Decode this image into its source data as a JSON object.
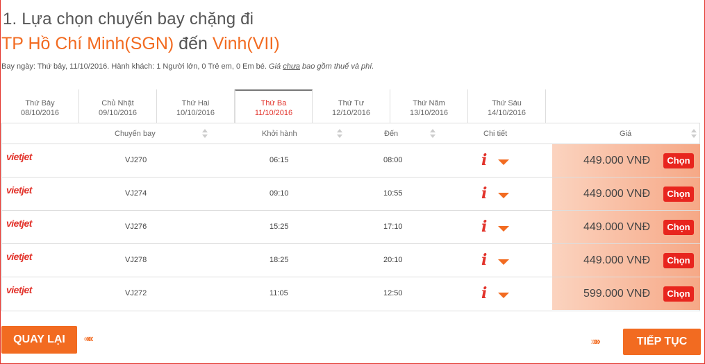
{
  "header": {
    "title": "1. Lựa chọn chuyến bay chặng đi",
    "origin": "TP Hồ Chí Minh(SGN)",
    "connector": "đến",
    "destination": "Vinh(VII)",
    "info": "Bay ngày: Thứ bảy, 11/10/2016. Hành khách: 1 Người lớn, 0 Trẻ em, 0 Em bé.",
    "tax_prefix": "Giá",
    "tax_underlined": "chưa",
    "tax_suffix": "bao gồm thuế và phí."
  },
  "date_tabs": [
    {
      "day": "Thứ Bảy",
      "date": "08/10/2016"
    },
    {
      "day": "Chủ Nhật",
      "date": "09/10/2016"
    },
    {
      "day": "Thứ Hai",
      "date": "10/10/2016"
    },
    {
      "day": "Thứ Ba",
      "date": "11/10/2016",
      "active": true
    },
    {
      "day": "Thứ Tư",
      "date": "12/10/2016"
    },
    {
      "day": "Thứ Năm",
      "date": "13/10/2016"
    },
    {
      "day": "Thứ Sáu",
      "date": "14/10/2016"
    }
  ],
  "table": {
    "headers": {
      "flight": "Chuyến bay",
      "depart": "Khởi hành",
      "arrive": "Đến",
      "detail": "Chi tiết",
      "price": "Giá"
    },
    "airline_logo": "vietjet",
    "select_label": "Chọn",
    "rows": [
      {
        "flight": "VJ270",
        "depart": "06:15",
        "arrive": "08:00",
        "price": "449.000 VNĐ"
      },
      {
        "flight": "VJ274",
        "depart": "09:10",
        "arrive": "10:55",
        "price": "449.000 VNĐ"
      },
      {
        "flight": "VJ276",
        "depart": "15:25",
        "arrive": "17:10",
        "price": "449.000 VNĐ"
      },
      {
        "flight": "VJ278",
        "depart": "18:25",
        "arrive": "20:10",
        "price": "449.000 VNĐ"
      },
      {
        "flight": "VJ272",
        "depart": "11:05",
        "arrive": "12:50",
        "price": "599.000 VNĐ"
      }
    ]
  },
  "buttons": {
    "back": "QUAY LẠI",
    "next": "TIẾP TỤC"
  },
  "colors": {
    "accent": "#f26b21",
    "brand_red": "#e2332b",
    "select_red": "#e8251e"
  },
  "icons": {
    "info": "i",
    "caret": "caret-down",
    "back_arrows": "double-chevron-left",
    "next_arrows": "double-chevron-right"
  }
}
